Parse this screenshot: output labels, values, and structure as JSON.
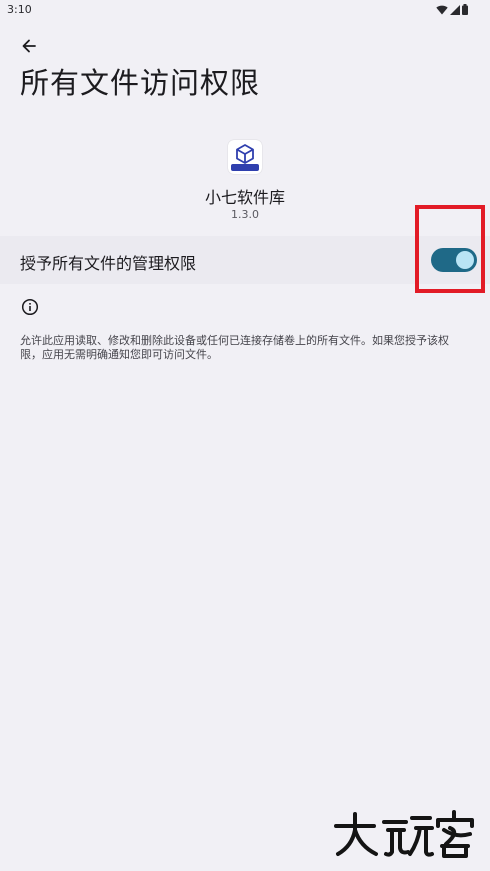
{
  "status_bar": {
    "time": "3:10"
  },
  "icons": {
    "back": "arrow-left-icon",
    "wifi": "wifi-icon",
    "signal": "signal-icon",
    "battery": "battery-icon",
    "info": "info-icon",
    "app": "cube-icon"
  },
  "header": {
    "title": "所有文件访问权限"
  },
  "app": {
    "name": "小七软件库",
    "version": "1.3.0"
  },
  "permission": {
    "label": "授予所有文件的管理权限",
    "toggle_on": true
  },
  "info": {
    "description": "允许此应用读取、修改和删除此设备或任何已连接存储卷上的所有文件。如果您授予该权限，应用无需明确通知您即可访问文件。"
  },
  "colors": {
    "background": "#f1f0f5",
    "toggle_track": "#1f6987",
    "toggle_thumb": "#b9e4f5",
    "highlight": "#e21b26",
    "app_icon_accent": "#2f3fae"
  }
}
